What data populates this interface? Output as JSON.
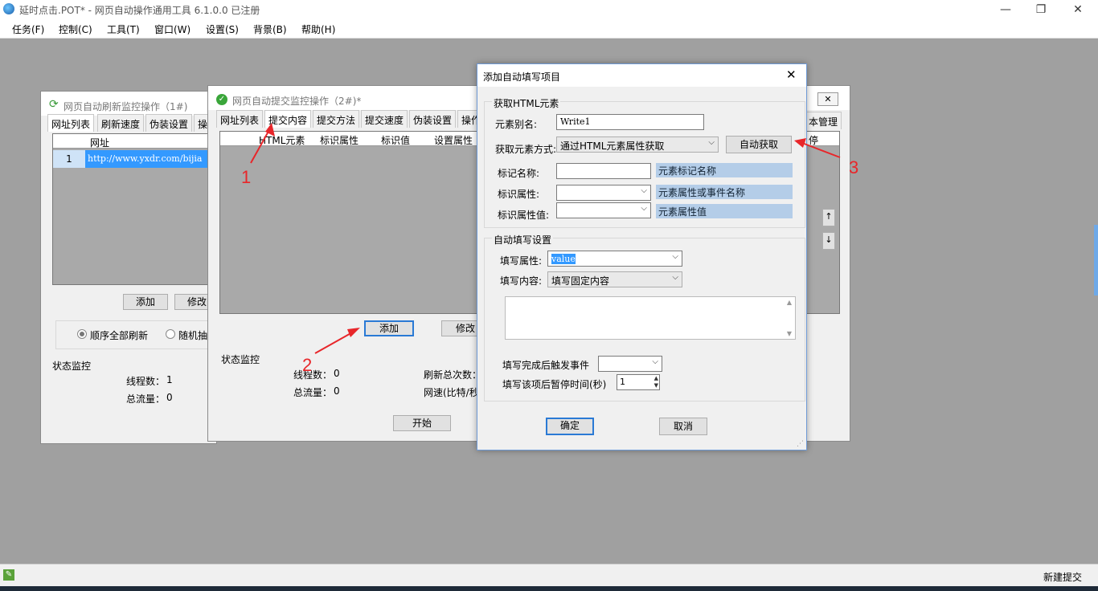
{
  "app": {
    "title": "延时点击.POT* - 网页自动操作通用工具 6.1.0.0  已注册",
    "min_glyph": "—",
    "restore_glyph": "❐",
    "close_glyph": "✕"
  },
  "menu": {
    "items": [
      "任务(F)",
      "控制(C)",
      "工具(T)",
      "窗口(W)",
      "设置(S)",
      "背景(B)",
      "帮助(H)"
    ]
  },
  "win1": {
    "title": "网页自动刷新监控操作（1#)",
    "tabs": [
      "网址列表",
      "刷新速度",
      "伪装设置",
      "操"
    ],
    "col_url": "网址",
    "row_num": "1",
    "row_url": "http://www.yxdr.com/bijia",
    "btn_add": "添加",
    "btn_edit": "修改",
    "radio_seq": "顺序全部刷新",
    "radio_rand": "随机抽",
    "status_title": "状态监控",
    "threads_label": "线程数：",
    "threads_val": "1",
    "traffic_label": "总流量：",
    "traffic_val": "0"
  },
  "win2": {
    "title": "网页自动提交监控操作（2#)*",
    "tabs": [
      "网址列表",
      "提交内容",
      "提交方法",
      "提交速度",
      "伪装设置",
      "操作"
    ],
    "right_tab": "本管理",
    "cols": [
      "HTML元素",
      "标识属性",
      "标识值",
      "设置属性"
    ],
    "right_col": "停",
    "btn_add": "添加",
    "btn_edit": "修改",
    "status_title": "状态监控",
    "threads_label": "线程数：",
    "threads_val": "0",
    "traffic_label": "总流量：",
    "traffic_val": "0",
    "refresh_label": "刷新总次数：",
    "speed_label": "网速(比特/秒",
    "btn_start": "开始",
    "up_arrow": "↑",
    "down_arrow": "↓"
  },
  "dialog": {
    "title": "添加自动填写项目",
    "close_glyph": "✕",
    "section1": "获取HTML元素",
    "alias_label": "元素别名:",
    "alias_value": "Write1",
    "method_label": "获取元素方式:",
    "method_value": "通过HTML元素属性获取",
    "auto_btn": "自动获取",
    "tag_label": "标记名称:",
    "tag_hint": "元素标记名称",
    "attr_label": "标识属性:",
    "attr_hint": "元素属性或事件名称",
    "attrval_label": "标识属性值:",
    "attrval_hint": "元素属性值",
    "section2": "自动填写设置",
    "fill_attr_label": "填写属性:",
    "fill_attr_value": "value",
    "fill_content_label": "填写内容:",
    "fill_content_value": "填写固定内容",
    "trigger_label": "填写完成后触发事件",
    "pause_label": "填写该项后暂停时间(秒)",
    "pause_value": "1",
    "ok_btn": "确定",
    "cancel_btn": "取消"
  },
  "annotations": [
    "1",
    "2",
    "3"
  ],
  "statusbar": {
    "right_text": "新建提交"
  },
  "colors": {
    "annotation": "#e8262a",
    "hint_bg": "#b4cde8",
    "focus_blue": "#2a7ad5"
  }
}
